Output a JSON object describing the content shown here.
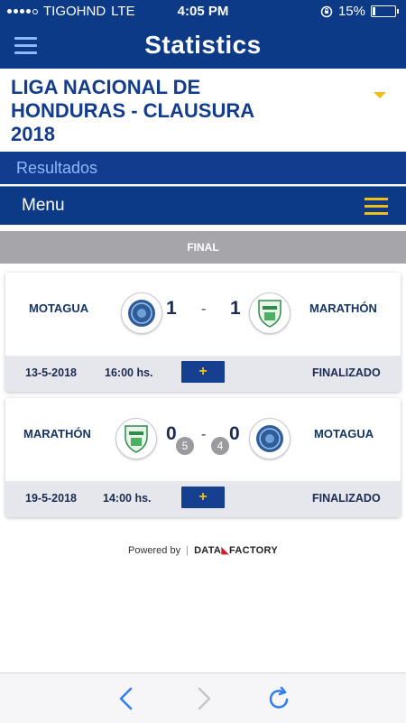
{
  "status_bar": {
    "carrier": "TIGOHND",
    "network": "LTE",
    "time": "4:05 PM",
    "battery": "15%"
  },
  "header": {
    "title": "Statistics"
  },
  "league": {
    "name_line1": "LIGA NACIONAL DE",
    "name_line2": "HONDURAS - CLAUSURA",
    "name_line3": "2018"
  },
  "section": {
    "results_label": "Resultados",
    "menu_label": "Menu"
  },
  "stage": {
    "label": "FINAL"
  },
  "matches": [
    {
      "home": "MOTAGUA",
      "away": "MARATHÓN",
      "home_score": "1",
      "away_score": "1",
      "separator": "-",
      "date": "13-5-2018",
      "time": "16:00 hs.",
      "plus": "+",
      "status": "FINALIZADO"
    },
    {
      "home": "MARATHÓN",
      "away": "MOTAGUA",
      "home_score": "0",
      "away_score": "0",
      "separator": "-",
      "home_penalties": "5",
      "away_penalties": "4",
      "date": "19-5-2018",
      "time": "14:00 hs.",
      "plus": "+",
      "status": "FINALIZADO"
    }
  ],
  "footer": {
    "powered_by": "Powered by",
    "brand_left": "DATA",
    "brand_right": "FACTORY"
  },
  "colors": {
    "primary": "#0d3a86",
    "accent": "#f0bd1a",
    "stage_bar": "#a5a5aa"
  },
  "icons": [
    "hamburger-icon",
    "menu-icon",
    "motagua-crest-icon",
    "marathon-crest-icon",
    "back-icon",
    "forward-icon",
    "reload-icon"
  ]
}
